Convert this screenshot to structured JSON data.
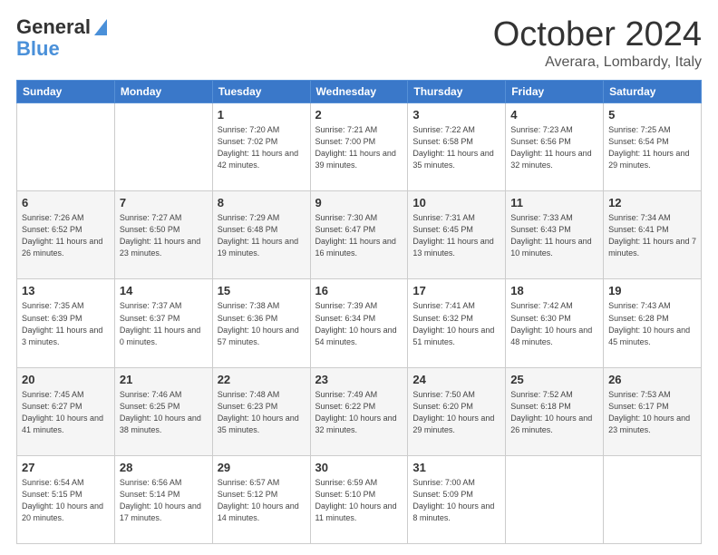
{
  "header": {
    "logo_general": "General",
    "logo_blue": "Blue",
    "title": "October 2024",
    "subtitle": "Averara, Lombardy, Italy"
  },
  "days_of_week": [
    "Sunday",
    "Monday",
    "Tuesday",
    "Wednesday",
    "Thursday",
    "Friday",
    "Saturday"
  ],
  "weeks": [
    [
      {
        "num": "",
        "info": ""
      },
      {
        "num": "",
        "info": ""
      },
      {
        "num": "1",
        "info": "Sunrise: 7:20 AM\nSunset: 7:02 PM\nDaylight: 11 hours and 42 minutes."
      },
      {
        "num": "2",
        "info": "Sunrise: 7:21 AM\nSunset: 7:00 PM\nDaylight: 11 hours and 39 minutes."
      },
      {
        "num": "3",
        "info": "Sunrise: 7:22 AM\nSunset: 6:58 PM\nDaylight: 11 hours and 35 minutes."
      },
      {
        "num": "4",
        "info": "Sunrise: 7:23 AM\nSunset: 6:56 PM\nDaylight: 11 hours and 32 minutes."
      },
      {
        "num": "5",
        "info": "Sunrise: 7:25 AM\nSunset: 6:54 PM\nDaylight: 11 hours and 29 minutes."
      }
    ],
    [
      {
        "num": "6",
        "info": "Sunrise: 7:26 AM\nSunset: 6:52 PM\nDaylight: 11 hours and 26 minutes."
      },
      {
        "num": "7",
        "info": "Sunrise: 7:27 AM\nSunset: 6:50 PM\nDaylight: 11 hours and 23 minutes."
      },
      {
        "num": "8",
        "info": "Sunrise: 7:29 AM\nSunset: 6:48 PM\nDaylight: 11 hours and 19 minutes."
      },
      {
        "num": "9",
        "info": "Sunrise: 7:30 AM\nSunset: 6:47 PM\nDaylight: 11 hours and 16 minutes."
      },
      {
        "num": "10",
        "info": "Sunrise: 7:31 AM\nSunset: 6:45 PM\nDaylight: 11 hours and 13 minutes."
      },
      {
        "num": "11",
        "info": "Sunrise: 7:33 AM\nSunset: 6:43 PM\nDaylight: 11 hours and 10 minutes."
      },
      {
        "num": "12",
        "info": "Sunrise: 7:34 AM\nSunset: 6:41 PM\nDaylight: 11 hours and 7 minutes."
      }
    ],
    [
      {
        "num": "13",
        "info": "Sunrise: 7:35 AM\nSunset: 6:39 PM\nDaylight: 11 hours and 3 minutes."
      },
      {
        "num": "14",
        "info": "Sunrise: 7:37 AM\nSunset: 6:37 PM\nDaylight: 11 hours and 0 minutes."
      },
      {
        "num": "15",
        "info": "Sunrise: 7:38 AM\nSunset: 6:36 PM\nDaylight: 10 hours and 57 minutes."
      },
      {
        "num": "16",
        "info": "Sunrise: 7:39 AM\nSunset: 6:34 PM\nDaylight: 10 hours and 54 minutes."
      },
      {
        "num": "17",
        "info": "Sunrise: 7:41 AM\nSunset: 6:32 PM\nDaylight: 10 hours and 51 minutes."
      },
      {
        "num": "18",
        "info": "Sunrise: 7:42 AM\nSunset: 6:30 PM\nDaylight: 10 hours and 48 minutes."
      },
      {
        "num": "19",
        "info": "Sunrise: 7:43 AM\nSunset: 6:28 PM\nDaylight: 10 hours and 45 minutes."
      }
    ],
    [
      {
        "num": "20",
        "info": "Sunrise: 7:45 AM\nSunset: 6:27 PM\nDaylight: 10 hours and 41 minutes."
      },
      {
        "num": "21",
        "info": "Sunrise: 7:46 AM\nSunset: 6:25 PM\nDaylight: 10 hours and 38 minutes."
      },
      {
        "num": "22",
        "info": "Sunrise: 7:48 AM\nSunset: 6:23 PM\nDaylight: 10 hours and 35 minutes."
      },
      {
        "num": "23",
        "info": "Sunrise: 7:49 AM\nSunset: 6:22 PM\nDaylight: 10 hours and 32 minutes."
      },
      {
        "num": "24",
        "info": "Sunrise: 7:50 AM\nSunset: 6:20 PM\nDaylight: 10 hours and 29 minutes."
      },
      {
        "num": "25",
        "info": "Sunrise: 7:52 AM\nSunset: 6:18 PM\nDaylight: 10 hours and 26 minutes."
      },
      {
        "num": "26",
        "info": "Sunrise: 7:53 AM\nSunset: 6:17 PM\nDaylight: 10 hours and 23 minutes."
      }
    ],
    [
      {
        "num": "27",
        "info": "Sunrise: 6:54 AM\nSunset: 5:15 PM\nDaylight: 10 hours and 20 minutes."
      },
      {
        "num": "28",
        "info": "Sunrise: 6:56 AM\nSunset: 5:14 PM\nDaylight: 10 hours and 17 minutes."
      },
      {
        "num": "29",
        "info": "Sunrise: 6:57 AM\nSunset: 5:12 PM\nDaylight: 10 hours and 14 minutes."
      },
      {
        "num": "30",
        "info": "Sunrise: 6:59 AM\nSunset: 5:10 PM\nDaylight: 10 hours and 11 minutes."
      },
      {
        "num": "31",
        "info": "Sunrise: 7:00 AM\nSunset: 5:09 PM\nDaylight: 10 hours and 8 minutes."
      },
      {
        "num": "",
        "info": ""
      },
      {
        "num": "",
        "info": ""
      }
    ]
  ]
}
